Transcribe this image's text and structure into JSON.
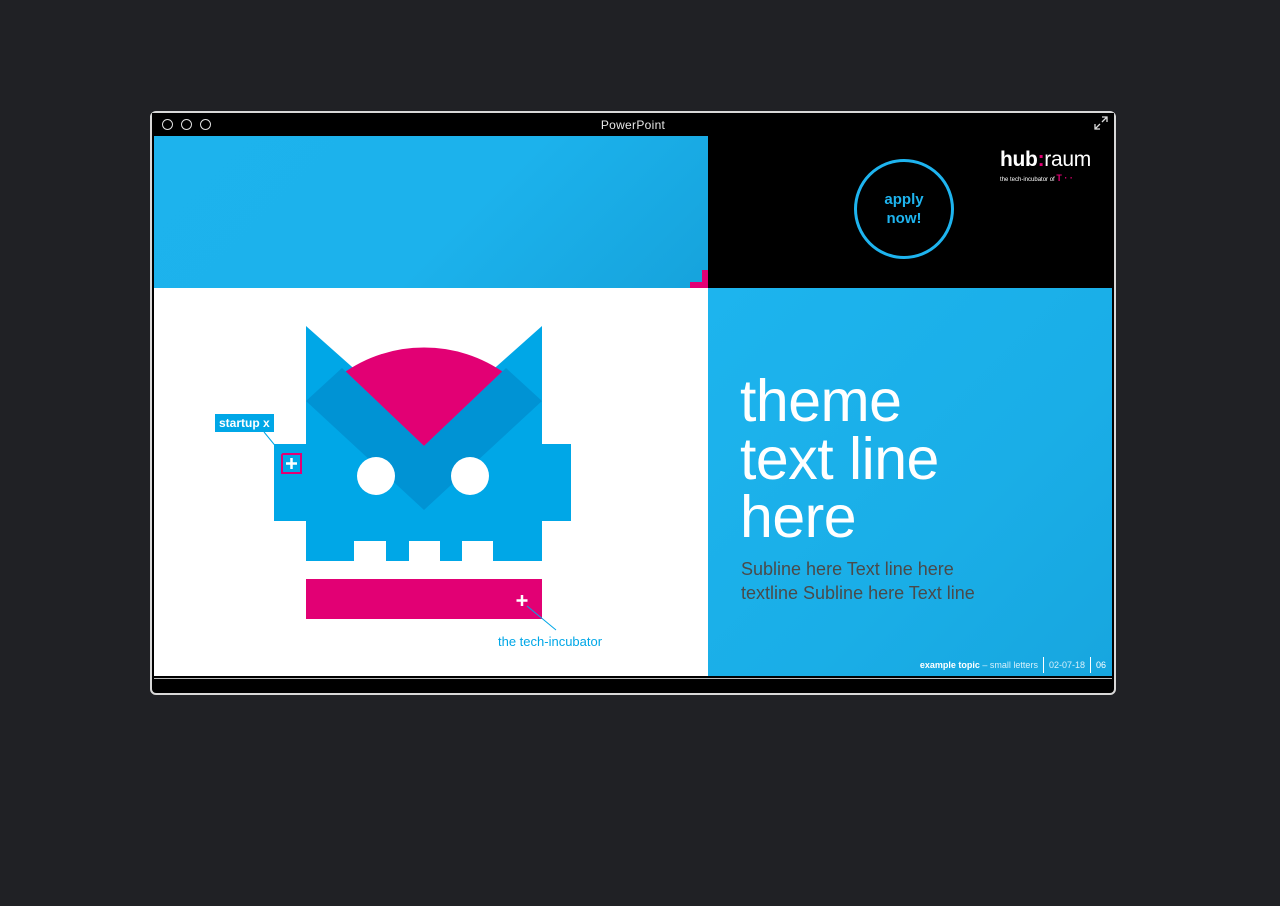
{
  "window": {
    "title": "PowerPoint"
  },
  "slide": {
    "apply_button": {
      "line1": "apply",
      "line2": "now!"
    },
    "logo": {
      "hub": "hub",
      "colon": ":",
      "raum": "raum",
      "tagline": "the tech-incubator of",
      "brand_mark": "T · ·"
    },
    "theme_text": {
      "line1": "theme",
      "line2": "text line",
      "line3": "here"
    },
    "subline": {
      "line1": "Subline here Text line here",
      "line2": "textline Subline here Text line"
    },
    "footer": {
      "topic_bold": "example topic",
      "topic_rest": "– small letters",
      "date": "02-07-18",
      "page": "06"
    },
    "labels": {
      "startup": "startup x",
      "incubator": "the tech-incubator"
    },
    "colors": {
      "blue": "#1db4ee",
      "magenta": "#e20074",
      "robot_blue": "#00a7e7",
      "robot_dark_blue": "#0093d4"
    }
  }
}
